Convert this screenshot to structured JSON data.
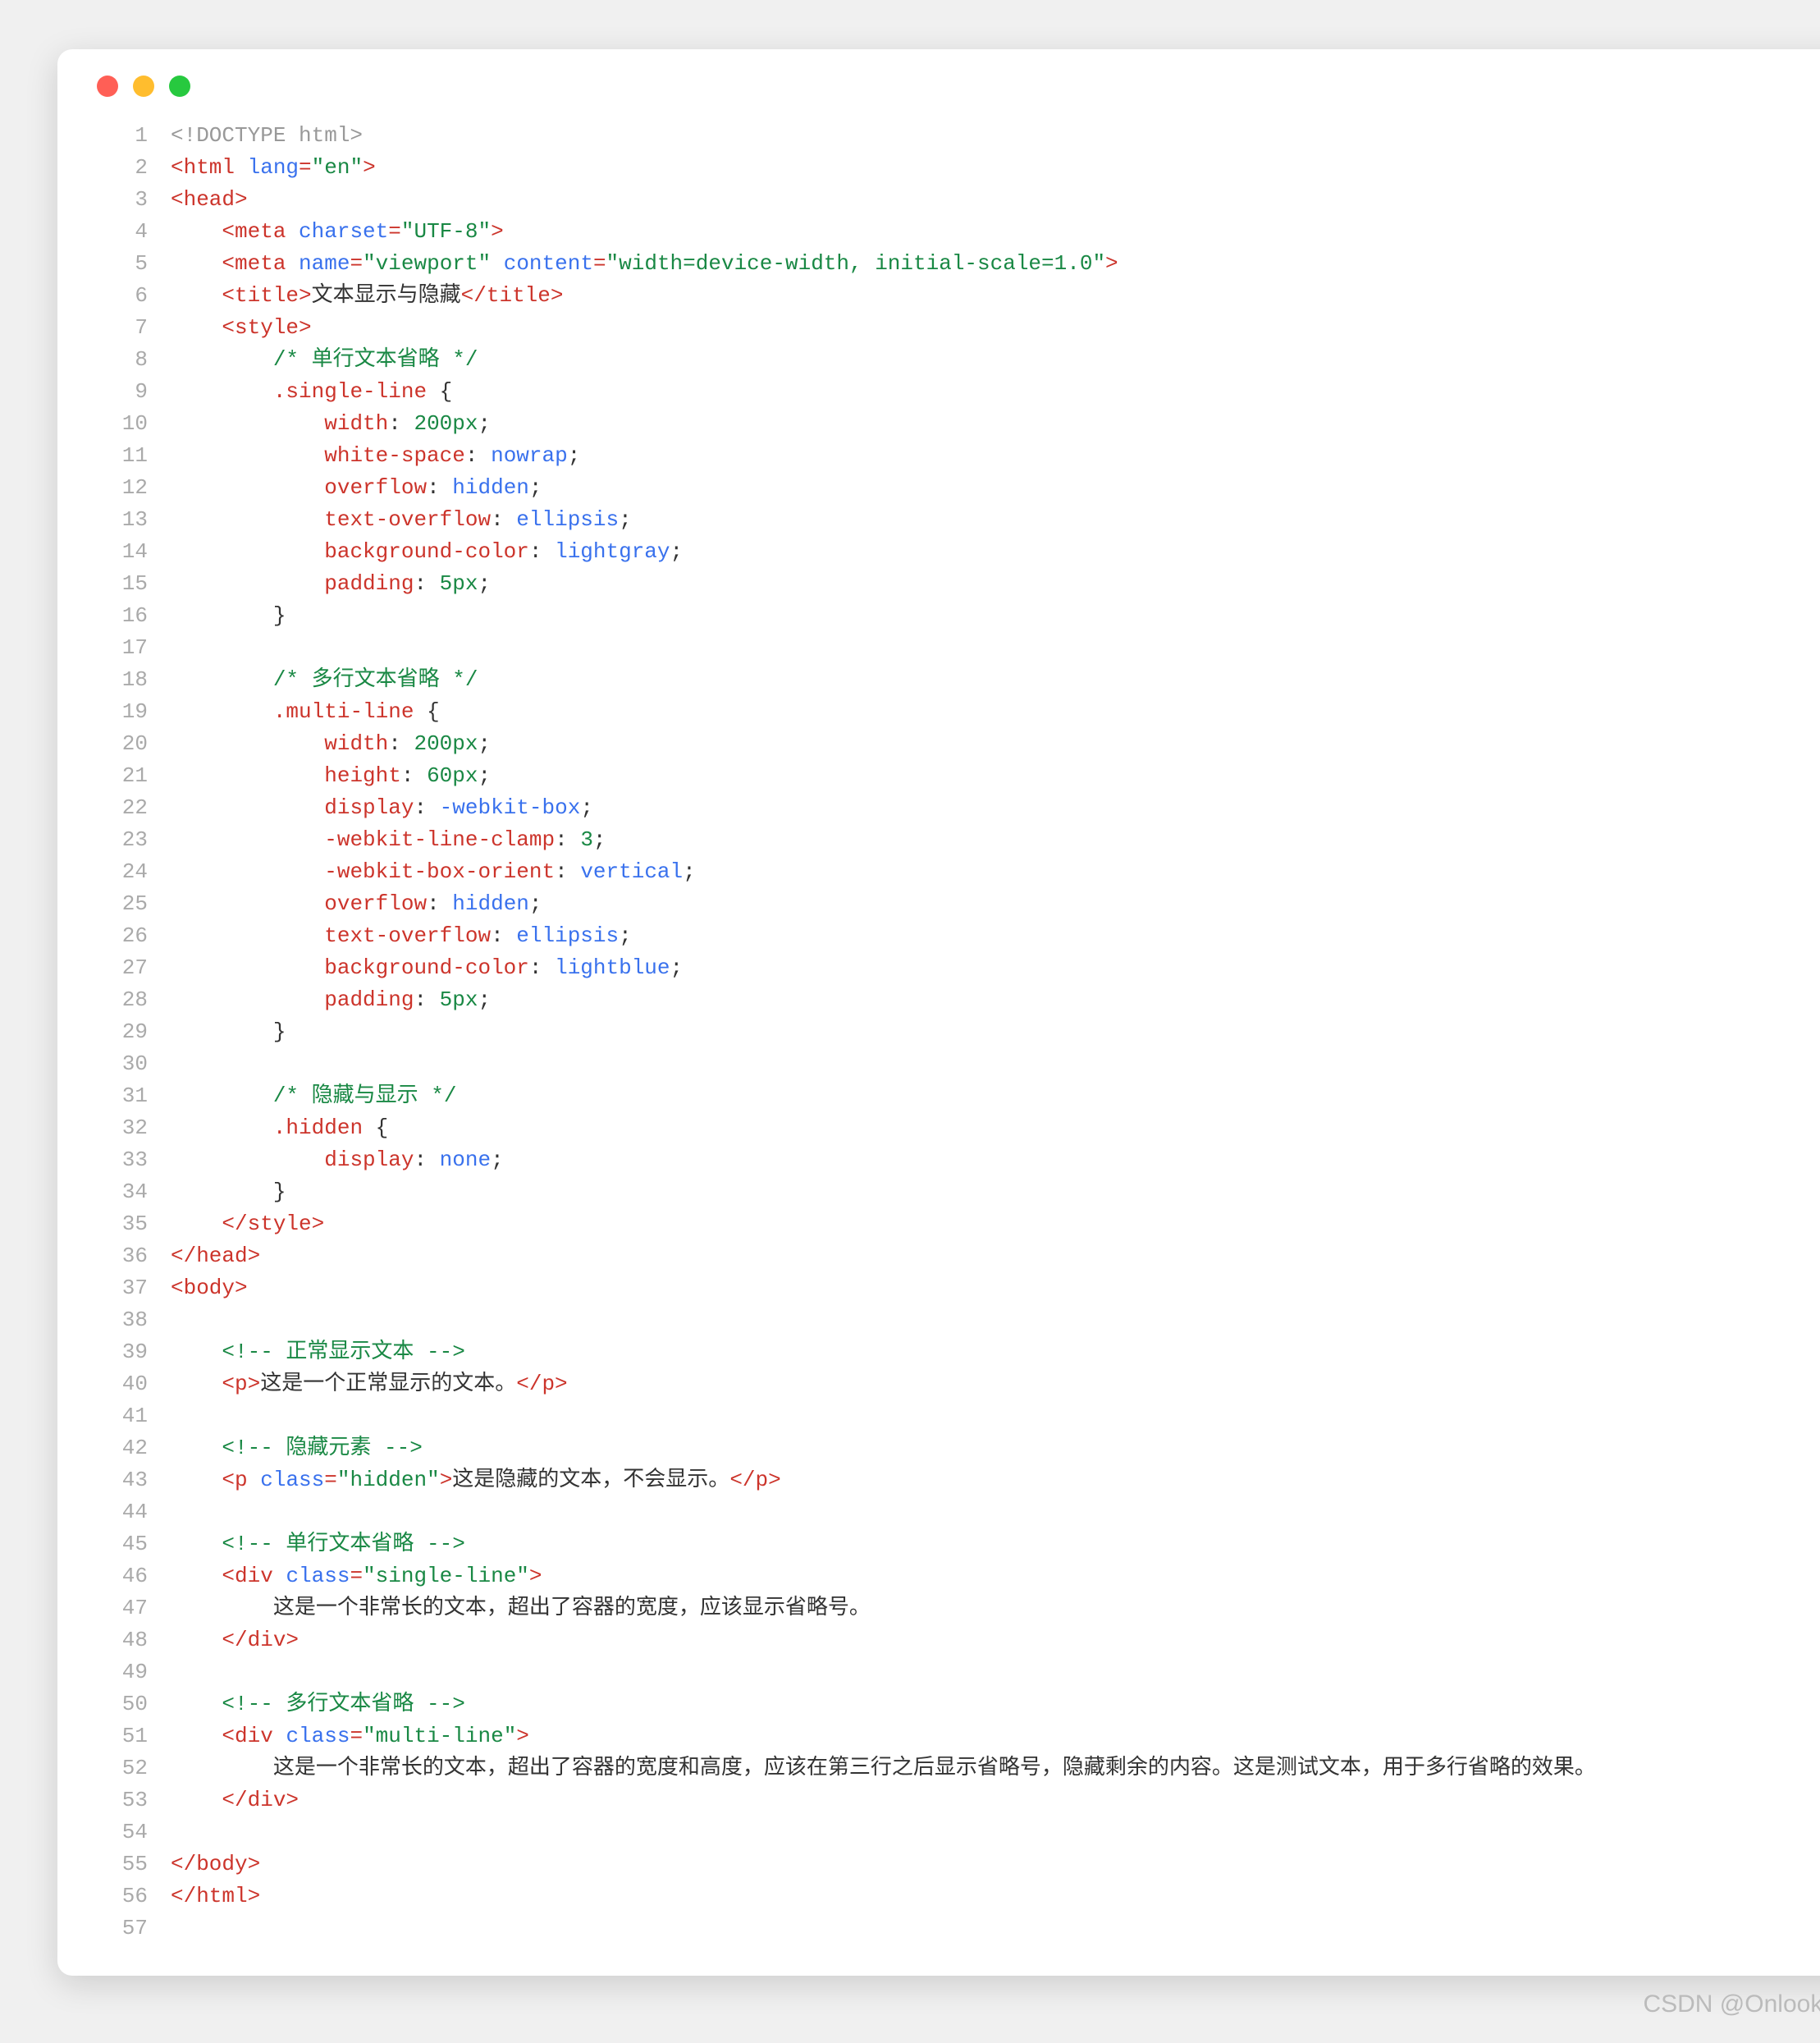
{
  "watermark": "CSDN @Onlooker…",
  "lines": [
    {
      "n": 1,
      "t": [
        [
          "c-doctype",
          "<!DOCTYPE html>"
        ]
      ]
    },
    {
      "n": 2,
      "t": [
        [
          "c-tag",
          "<html "
        ],
        [
          "c-attr",
          "lang"
        ],
        [
          "c-tag",
          "="
        ],
        [
          "c-string",
          "\"en\""
        ],
        [
          "c-tag",
          ">"
        ]
      ]
    },
    {
      "n": 3,
      "t": [
        [
          "c-tag",
          "<head>"
        ]
      ]
    },
    {
      "n": 4,
      "t": [
        [
          "c-plain",
          "    "
        ],
        [
          "c-tag",
          "<meta "
        ],
        [
          "c-attr",
          "charset"
        ],
        [
          "c-tag",
          "="
        ],
        [
          "c-string",
          "\"UTF-8\""
        ],
        [
          "c-tag",
          ">"
        ]
      ]
    },
    {
      "n": 5,
      "t": [
        [
          "c-plain",
          "    "
        ],
        [
          "c-tag",
          "<meta "
        ],
        [
          "c-attr",
          "name"
        ],
        [
          "c-tag",
          "="
        ],
        [
          "c-string",
          "\"viewport\""
        ],
        [
          "c-tag",
          " "
        ],
        [
          "c-attr",
          "content"
        ],
        [
          "c-tag",
          "="
        ],
        [
          "c-string",
          "\"width=device-width, initial-scale=1.0\""
        ],
        [
          "c-tag",
          ">"
        ]
      ]
    },
    {
      "n": 6,
      "t": [
        [
          "c-plain",
          "    "
        ],
        [
          "c-tag",
          "<title>"
        ],
        [
          "c-plain",
          "文本显示与隐藏"
        ],
        [
          "c-tag",
          "</title>"
        ]
      ]
    },
    {
      "n": 7,
      "t": [
        [
          "c-plain",
          "    "
        ],
        [
          "c-tag",
          "<style>"
        ]
      ]
    },
    {
      "n": 8,
      "t": [
        [
          "c-plain",
          "        "
        ],
        [
          "c-comment",
          "/* 单行文本省略 */"
        ]
      ]
    },
    {
      "n": 9,
      "t": [
        [
          "c-plain",
          "        "
        ],
        [
          "c-prop",
          ".single-line"
        ],
        [
          "c-plain",
          " {"
        ]
      ]
    },
    {
      "n": 10,
      "t": [
        [
          "c-plain",
          "            "
        ],
        [
          "c-prop",
          "width"
        ],
        [
          "c-plain",
          ": "
        ],
        [
          "c-num",
          "200px"
        ],
        [
          "c-plain",
          ";"
        ]
      ]
    },
    {
      "n": 11,
      "t": [
        [
          "c-plain",
          "            "
        ],
        [
          "c-prop",
          "white-space"
        ],
        [
          "c-plain",
          ": "
        ],
        [
          "c-value",
          "nowrap"
        ],
        [
          "c-plain",
          ";"
        ]
      ]
    },
    {
      "n": 12,
      "t": [
        [
          "c-plain",
          "            "
        ],
        [
          "c-prop",
          "overflow"
        ],
        [
          "c-plain",
          ": "
        ],
        [
          "c-value",
          "hidden"
        ],
        [
          "c-plain",
          ";"
        ]
      ]
    },
    {
      "n": 13,
      "t": [
        [
          "c-plain",
          "            "
        ],
        [
          "c-prop",
          "text-overflow"
        ],
        [
          "c-plain",
          ": "
        ],
        [
          "c-value",
          "ellipsis"
        ],
        [
          "c-plain",
          ";"
        ]
      ]
    },
    {
      "n": 14,
      "t": [
        [
          "c-plain",
          "            "
        ],
        [
          "c-prop",
          "background-color"
        ],
        [
          "c-plain",
          ": "
        ],
        [
          "c-value",
          "lightgray"
        ],
        [
          "c-plain",
          ";"
        ]
      ]
    },
    {
      "n": 15,
      "t": [
        [
          "c-plain",
          "            "
        ],
        [
          "c-prop",
          "padding"
        ],
        [
          "c-plain",
          ": "
        ],
        [
          "c-num",
          "5px"
        ],
        [
          "c-plain",
          ";"
        ]
      ]
    },
    {
      "n": 16,
      "t": [
        [
          "c-plain",
          "        }"
        ]
      ]
    },
    {
      "n": 17,
      "t": [
        [
          "c-plain",
          ""
        ]
      ]
    },
    {
      "n": 18,
      "t": [
        [
          "c-plain",
          "        "
        ],
        [
          "c-comment",
          "/* 多行文本省略 */"
        ]
      ]
    },
    {
      "n": 19,
      "t": [
        [
          "c-plain",
          "        "
        ],
        [
          "c-prop",
          ".multi-line"
        ],
        [
          "c-plain",
          " {"
        ]
      ]
    },
    {
      "n": 20,
      "t": [
        [
          "c-plain",
          "            "
        ],
        [
          "c-prop",
          "width"
        ],
        [
          "c-plain",
          ": "
        ],
        [
          "c-num",
          "200px"
        ],
        [
          "c-plain",
          ";"
        ]
      ]
    },
    {
      "n": 21,
      "t": [
        [
          "c-plain",
          "            "
        ],
        [
          "c-prop",
          "height"
        ],
        [
          "c-plain",
          ": "
        ],
        [
          "c-num",
          "60px"
        ],
        [
          "c-plain",
          ";"
        ]
      ]
    },
    {
      "n": 22,
      "t": [
        [
          "c-plain",
          "            "
        ],
        [
          "c-prop",
          "display"
        ],
        [
          "c-plain",
          ": "
        ],
        [
          "c-value",
          "-webkit-box"
        ],
        [
          "c-plain",
          ";"
        ]
      ]
    },
    {
      "n": 23,
      "t": [
        [
          "c-plain",
          "            "
        ],
        [
          "c-prop",
          "-webkit-line-clamp"
        ],
        [
          "c-plain",
          ": "
        ],
        [
          "c-num",
          "3"
        ],
        [
          "c-plain",
          ";"
        ]
      ]
    },
    {
      "n": 24,
      "t": [
        [
          "c-plain",
          "            "
        ],
        [
          "c-prop",
          "-webkit-box-orient"
        ],
        [
          "c-plain",
          ": "
        ],
        [
          "c-value",
          "vertical"
        ],
        [
          "c-plain",
          ";"
        ]
      ]
    },
    {
      "n": 25,
      "t": [
        [
          "c-plain",
          "            "
        ],
        [
          "c-prop",
          "overflow"
        ],
        [
          "c-plain",
          ": "
        ],
        [
          "c-value",
          "hidden"
        ],
        [
          "c-plain",
          ";"
        ]
      ]
    },
    {
      "n": 26,
      "t": [
        [
          "c-plain",
          "            "
        ],
        [
          "c-prop",
          "text-overflow"
        ],
        [
          "c-plain",
          ": "
        ],
        [
          "c-value",
          "ellipsis"
        ],
        [
          "c-plain",
          ";"
        ]
      ]
    },
    {
      "n": 27,
      "t": [
        [
          "c-plain",
          "            "
        ],
        [
          "c-prop",
          "background-color"
        ],
        [
          "c-plain",
          ": "
        ],
        [
          "c-value",
          "lightblue"
        ],
        [
          "c-plain",
          ";"
        ]
      ]
    },
    {
      "n": 28,
      "t": [
        [
          "c-plain",
          "            "
        ],
        [
          "c-prop",
          "padding"
        ],
        [
          "c-plain",
          ": "
        ],
        [
          "c-num",
          "5px"
        ],
        [
          "c-plain",
          ";"
        ]
      ]
    },
    {
      "n": 29,
      "t": [
        [
          "c-plain",
          "        }"
        ]
      ]
    },
    {
      "n": 30,
      "t": [
        [
          "c-plain",
          ""
        ]
      ]
    },
    {
      "n": 31,
      "t": [
        [
          "c-plain",
          "        "
        ],
        [
          "c-comment",
          "/* 隐藏与显示 */"
        ]
      ]
    },
    {
      "n": 32,
      "t": [
        [
          "c-plain",
          "        "
        ],
        [
          "c-prop",
          ".hidden"
        ],
        [
          "c-plain",
          " {"
        ]
      ]
    },
    {
      "n": 33,
      "t": [
        [
          "c-plain",
          "            "
        ],
        [
          "c-prop",
          "display"
        ],
        [
          "c-plain",
          ": "
        ],
        [
          "c-value",
          "none"
        ],
        [
          "c-plain",
          ";"
        ]
      ]
    },
    {
      "n": 34,
      "t": [
        [
          "c-plain",
          "        }"
        ]
      ]
    },
    {
      "n": 35,
      "t": [
        [
          "c-plain",
          "    "
        ],
        [
          "c-tag",
          "</style>"
        ]
      ]
    },
    {
      "n": 36,
      "t": [
        [
          "c-tag",
          "</head>"
        ]
      ]
    },
    {
      "n": 37,
      "t": [
        [
          "c-tag",
          "<body>"
        ]
      ]
    },
    {
      "n": 38,
      "t": [
        [
          "c-plain",
          ""
        ]
      ]
    },
    {
      "n": 39,
      "t": [
        [
          "c-plain",
          "    "
        ],
        [
          "c-comment",
          "<!-- 正常显示文本 -->"
        ]
      ]
    },
    {
      "n": 40,
      "t": [
        [
          "c-plain",
          "    "
        ],
        [
          "c-tag",
          "<p>"
        ],
        [
          "c-plain",
          "这是一个正常显示的文本。"
        ],
        [
          "c-tag",
          "</p>"
        ]
      ]
    },
    {
      "n": 41,
      "t": [
        [
          "c-plain",
          ""
        ]
      ]
    },
    {
      "n": 42,
      "t": [
        [
          "c-plain",
          "    "
        ],
        [
          "c-comment",
          "<!-- 隐藏元素 -->"
        ]
      ]
    },
    {
      "n": 43,
      "t": [
        [
          "c-plain",
          "    "
        ],
        [
          "c-tag",
          "<p "
        ],
        [
          "c-attr",
          "class"
        ],
        [
          "c-tag",
          "="
        ],
        [
          "c-string",
          "\"hidden\""
        ],
        [
          "c-tag",
          ">"
        ],
        [
          "c-plain",
          "这是隐藏的文本，不会显示。"
        ],
        [
          "c-tag",
          "</p>"
        ]
      ]
    },
    {
      "n": 44,
      "t": [
        [
          "c-plain",
          ""
        ]
      ]
    },
    {
      "n": 45,
      "t": [
        [
          "c-plain",
          "    "
        ],
        [
          "c-comment",
          "<!-- 单行文本省略 -->"
        ]
      ]
    },
    {
      "n": 46,
      "t": [
        [
          "c-plain",
          "    "
        ],
        [
          "c-tag",
          "<div "
        ],
        [
          "c-attr",
          "class"
        ],
        [
          "c-tag",
          "="
        ],
        [
          "c-string",
          "\"single-line\""
        ],
        [
          "c-tag",
          ">"
        ]
      ]
    },
    {
      "n": 47,
      "t": [
        [
          "c-plain",
          "        这是一个非常长的文本，超出了容器的宽度，应该显示省略号。"
        ]
      ]
    },
    {
      "n": 48,
      "t": [
        [
          "c-plain",
          "    "
        ],
        [
          "c-tag",
          "</div>"
        ]
      ]
    },
    {
      "n": 49,
      "t": [
        [
          "c-plain",
          ""
        ]
      ]
    },
    {
      "n": 50,
      "t": [
        [
          "c-plain",
          "    "
        ],
        [
          "c-comment",
          "<!-- 多行文本省略 -->"
        ]
      ]
    },
    {
      "n": 51,
      "t": [
        [
          "c-plain",
          "    "
        ],
        [
          "c-tag",
          "<div "
        ],
        [
          "c-attr",
          "class"
        ],
        [
          "c-tag",
          "="
        ],
        [
          "c-string",
          "\"multi-line\""
        ],
        [
          "c-tag",
          ">"
        ]
      ]
    },
    {
      "n": 52,
      "t": [
        [
          "c-plain",
          "        这是一个非常长的文本，超出了容器的宽度和高度，应该在第三行之后显示省略号，隐藏剩余的内容。这是测试文本，用于多行省略的效果。"
        ]
      ]
    },
    {
      "n": 53,
      "t": [
        [
          "c-plain",
          "    "
        ],
        [
          "c-tag",
          "</div>"
        ]
      ]
    },
    {
      "n": 54,
      "t": [
        [
          "c-plain",
          ""
        ]
      ]
    },
    {
      "n": 55,
      "t": [
        [
          "c-tag",
          "</body>"
        ]
      ]
    },
    {
      "n": 56,
      "t": [
        [
          "c-tag",
          "</html>"
        ]
      ]
    },
    {
      "n": 57,
      "t": [
        [
          "c-plain",
          ""
        ]
      ]
    }
  ]
}
